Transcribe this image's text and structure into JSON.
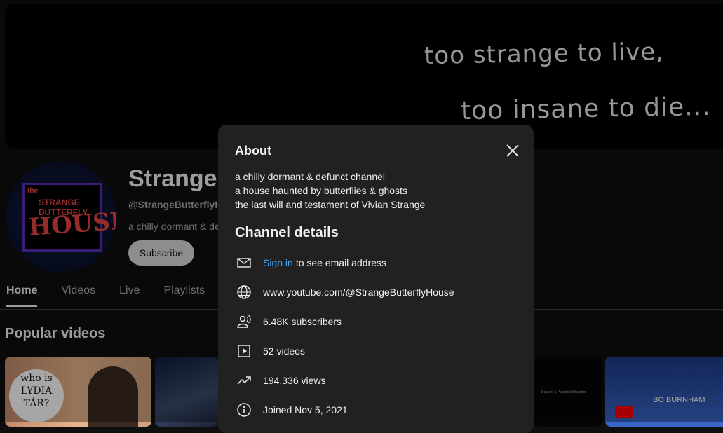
{
  "banner": {
    "line1": "too strange to live,",
    "line2": "too insane to die..."
  },
  "avatar": {
    "line1": "the",
    "line2": "STRANGE BUTTERFLY",
    "line3": "HOUSE"
  },
  "channel": {
    "title": "Strange",
    "handle": "@StrangeButterflyHo",
    "desc_preview": "a chilly dormant & de",
    "subscribe_label": "Subscribe"
  },
  "tabs": [
    {
      "label": "Home"
    },
    {
      "label": "Videos"
    },
    {
      "label": "Live"
    },
    {
      "label": "Playlists"
    }
  ],
  "section_title": "Popular videos",
  "thumbs": {
    "t1_text": "who is LYDIA TÁR?",
    "t3_text": "Diary of a Pakistani Dreamer",
    "t4_text": "BO BURNHAM"
  },
  "modal": {
    "title": "About",
    "description": [
      "a chilly dormant & defunct channel",
      "a house haunted by butterflies & ghosts",
      "the last will and testament of Vivian Strange"
    ],
    "details_title": "Channel details",
    "sign_in_link": "Sign in",
    "email_text": "to see email address",
    "url": "www.youtube.com/@StrangeButterflyHouse",
    "subscribers": "6.48K subscribers",
    "videos": "52 videos",
    "views": "194,336 views",
    "joined": "Joined Nov 5, 2021"
  },
  "icons": [
    "mail-icon",
    "globe-icon",
    "subscribers-icon",
    "video-icon",
    "trending-icon",
    "info-icon",
    "close-icon"
  ]
}
